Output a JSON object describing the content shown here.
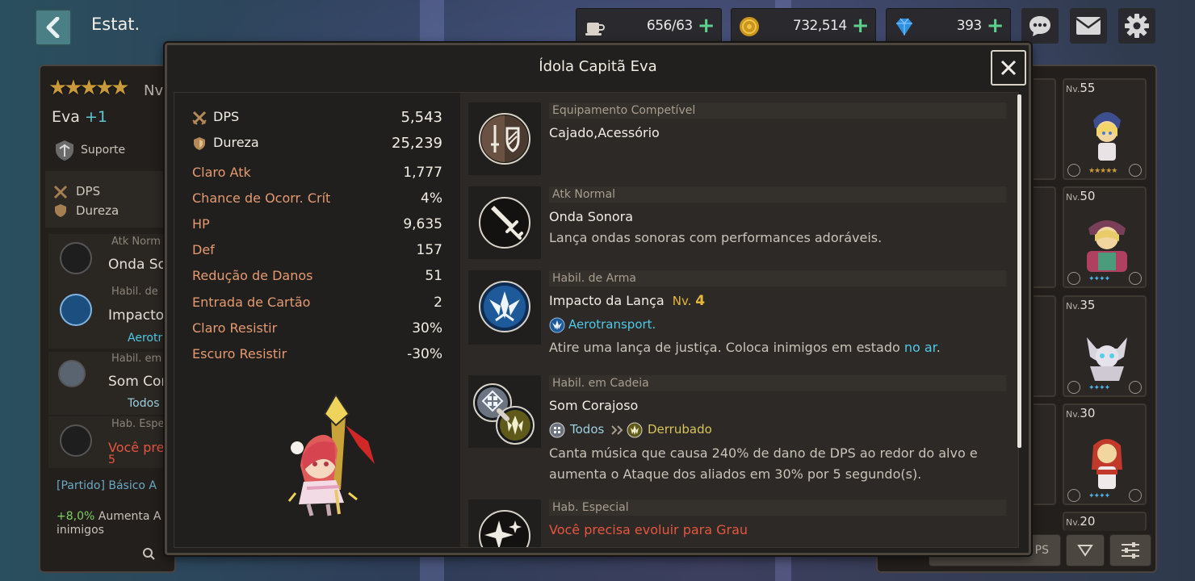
{
  "header": {
    "page_title": "Estat.",
    "stamina": "656/63",
    "gold": "732,514",
    "gems": "393"
  },
  "left_panel": {
    "level_prefix": "Nv",
    "name": "Eva",
    "name_plus": "+1",
    "role": "Suporte",
    "stat1": "DPS",
    "stat2": "Dureza",
    "rows": [
      {
        "cat": "Atk Norm",
        "name": "Onda So"
      },
      {
        "cat": "Habil. de",
        "name": "Impacto",
        "sub": "Aerotr"
      },
      {
        "cat": "Habil. em",
        "name": "Som Cor",
        "sub": "Todos"
      },
      {
        "cat": "Hab. Espe",
        "name": "Você pre",
        "name2": "5"
      }
    ],
    "party": "[Partido] Básico A",
    "bonus_pct": "+8,0%",
    "bonus_text": " Aumenta A",
    "bonus_text2": "inimigos"
  },
  "right_panel": {
    "cards": [
      {
        "nv": "55"
      },
      {
        "nv": "50"
      },
      {
        "nv": "35"
      },
      {
        "nv": "30"
      },
      {
        "nv": "20"
      }
    ],
    "sort_label": "PS"
  },
  "modal": {
    "title": "Ídola Capitã Eva",
    "stats_main": [
      {
        "label": "DPS",
        "value": "5,543"
      },
      {
        "label": "Dureza",
        "value": "25,239"
      }
    ],
    "stats": [
      {
        "label": "Claro Atk",
        "value": "1,777"
      },
      {
        "label": "Chance de Ocorr. Crít",
        "value": "4%"
      },
      {
        "label": "HP",
        "value": "9,635"
      },
      {
        "label": "Def",
        "value": "157"
      },
      {
        "label": "Redução de Danos",
        "value": "51"
      },
      {
        "label": "Entrada de Cartão",
        "value": "2"
      },
      {
        "label": "Claro Resistir",
        "value": "30%"
      },
      {
        "label": "Escuro Resistir",
        "value": "-30%"
      }
    ],
    "skills": {
      "equip": {
        "category": "Equipamento Competível",
        "name": "Cajado,Acessório"
      },
      "normal": {
        "category": "Atk Normal",
        "name": "Onda Sonora",
        "desc": "Lança ondas sonoras com performances adoráveis."
      },
      "weapon": {
        "category": "Habil. de Arma",
        "name": "Impacto da Lança",
        "level_prefix": "Nv.",
        "level": "4",
        "tag": "Aerotransport.",
        "desc_before": "Atire uma lança de justiça. Coloca inimigos em estado ",
        "desc_highlight": "no ar",
        "desc_after": "."
      },
      "chain": {
        "category": "Habil. em Cadeia",
        "name": "Som Corajoso",
        "tag_from": "Todos",
        "tag_to": "Derrubado",
        "desc_line1": "Canta música que causa 240% de dano de DPS ao redor do alvo e",
        "desc_line2": "aumenta o Ataque dos aliados em 30% por 5 segundo(s)."
      },
      "special": {
        "category": "Hab. Especial",
        "name": "Você precisa evoluir para Grau"
      }
    }
  }
}
